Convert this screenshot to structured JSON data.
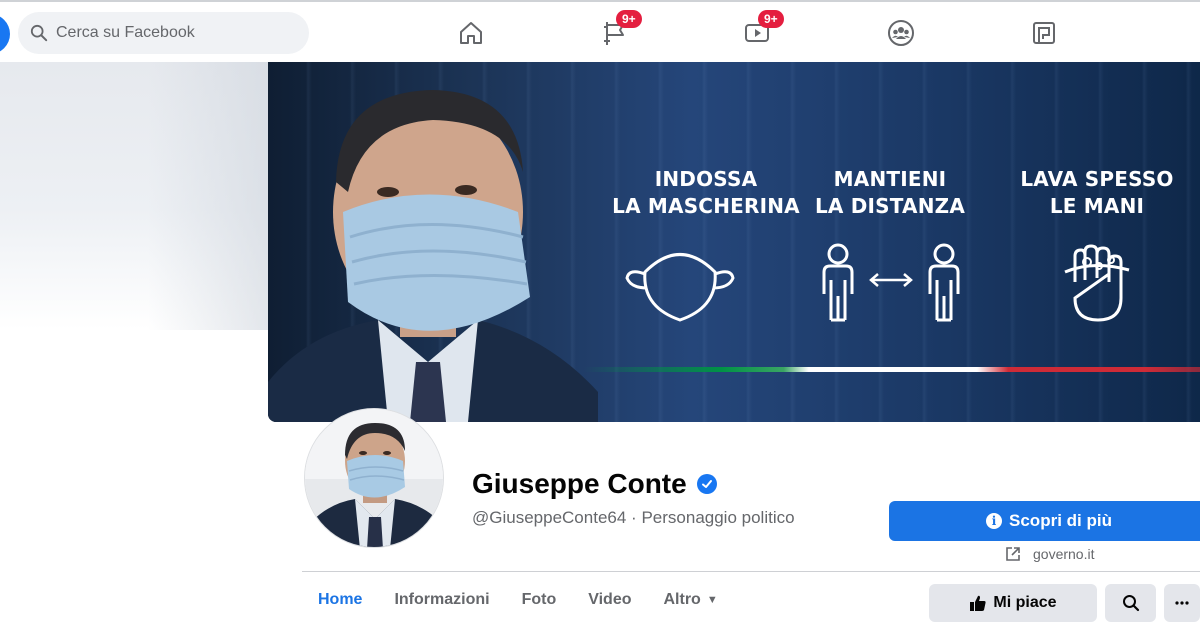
{
  "header": {
    "search_placeholder": "Cerca su Facebook",
    "nav": [
      {
        "name": "home",
        "badge": ""
      },
      {
        "name": "pages",
        "badge": "9+"
      },
      {
        "name": "watch",
        "badge": "9+"
      },
      {
        "name": "groups",
        "badge": ""
      },
      {
        "name": "gaming",
        "badge": ""
      }
    ],
    "badge_pages": "9+",
    "badge_watch": "9+"
  },
  "cover": {
    "tips": [
      {
        "line1": "INDOSSA",
        "line2": "LA MASCHERINA",
        "icon": "face-mask-icon"
      },
      {
        "line1": "MANTIENI",
        "line2": "LA DISTANZA",
        "icon": "social-distance-icon"
      },
      {
        "line1": "LAVA SPESSO",
        "line2": "LE MANI",
        "icon": "hand-wash-icon"
      }
    ]
  },
  "profile": {
    "name": "Giuseppe Conte",
    "handle": "@GiuseppeConte64",
    "separator": "·",
    "category": "Personaggio politico",
    "cta_label": "Scopri di più",
    "website": "governo.it"
  },
  "tabs": [
    {
      "label": "Home",
      "active": true
    },
    {
      "label": "Informazioni",
      "active": false
    },
    {
      "label": "Foto",
      "active": false
    },
    {
      "label": "Video",
      "active": false
    },
    {
      "label": "Altro",
      "active": false
    }
  ],
  "actions": {
    "like_label": "Mi piace",
    "search_icon": "search-icon",
    "more_icon": "more-icon"
  },
  "colors": {
    "accent": "#1b74e4",
    "badge": "#e41e3f",
    "cover_blue": "#1c3456"
  }
}
